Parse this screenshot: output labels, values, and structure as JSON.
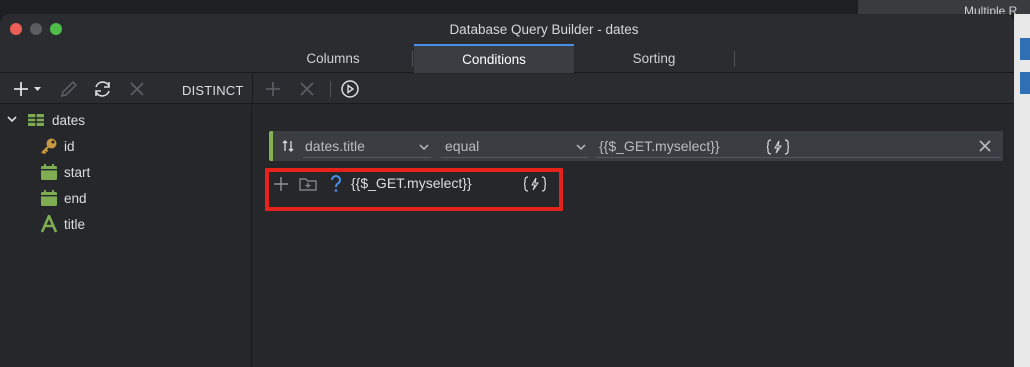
{
  "window": {
    "title": "Database Query Builder - dates"
  },
  "background": {
    "top_text": "Multiple R"
  },
  "tabs": [
    {
      "label": "Columns"
    },
    {
      "label": "Conditions",
      "active": true
    },
    {
      "label": "Sorting"
    }
  ],
  "toolbar": {
    "distinct_label": "DISTINCT",
    "icons": [
      "add-icon",
      "edit-icon",
      "refresh-icon",
      "delete-icon",
      "add-condition-icon",
      "remove-condition-icon",
      "run-icon"
    ]
  },
  "sidebar": {
    "table": {
      "name": "dates",
      "icon": "table-icon",
      "color": "#7fae52"
    },
    "columns": [
      {
        "name": "id",
        "icon": "key-icon",
        "color": "#c9983f"
      },
      {
        "name": "start",
        "icon": "calendar-icon",
        "color": "#7fae52"
      },
      {
        "name": "end",
        "icon": "calendar-icon",
        "color": "#7fae52"
      },
      {
        "name": "title",
        "icon": "text-icon",
        "color": "#7fae52"
      }
    ]
  },
  "condition": {
    "field": "dates.title",
    "operator": "equal",
    "value": "{{$_GET.myselect}}"
  },
  "sub_condition": {
    "value": "{{$_GET.myselect}}"
  },
  "colors": {
    "accent": "#4a8fe8",
    "condition_bar": "#83b255",
    "highlight": "#e5231b"
  }
}
